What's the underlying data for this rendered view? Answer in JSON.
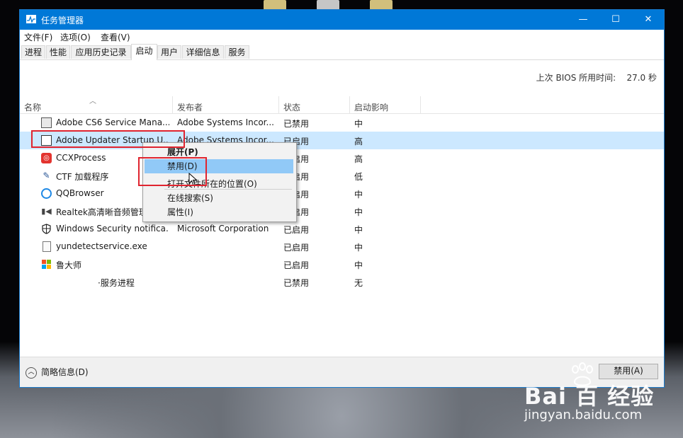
{
  "window": {
    "title": "任务管理器",
    "controls": {
      "minimize": "—",
      "maximize": "☐",
      "close": "✕"
    }
  },
  "menubar": [
    "文件(F)",
    "选项(O)",
    "查看(V)"
  ],
  "tabs": [
    {
      "label": "进程",
      "active": false
    },
    {
      "label": "性能",
      "active": false
    },
    {
      "label": "应用历史记录",
      "active": false
    },
    {
      "label": "启动",
      "active": true
    },
    {
      "label": "用户",
      "active": false
    },
    {
      "label": "详细信息",
      "active": false
    },
    {
      "label": "服务",
      "active": false
    }
  ],
  "bios": {
    "label": "上次 BIOS 所用时间:",
    "value": "27.0 秒"
  },
  "columns": {
    "name": "名称",
    "publisher": "发布者",
    "status": "状态",
    "impact": "启动影响"
  },
  "rows": [
    {
      "name": "Adobe CS6 Service Mana...",
      "publisher": "Adobe Systems Incor...",
      "status": "已禁用",
      "impact": "中",
      "icon": "adobe-cs6-icon",
      "selected": false
    },
    {
      "name": "Adobe Updater Startup U...",
      "publisher": "Adobe Systems Incor...",
      "status": "已启用",
      "impact": "高",
      "icon": "adobe-updater-icon",
      "selected": true
    },
    {
      "name": "CCXProcess",
      "publisher": "",
      "status": "已启用",
      "impact": "高",
      "icon": "ccx-process-icon",
      "selected": false
    },
    {
      "name": "CTF 加载程序",
      "publisher": "",
      "status": "已启用",
      "impact": "低",
      "icon": "ctf-loader-icon",
      "selected": false
    },
    {
      "name": "QQBrowser",
      "publisher": "",
      "status": "已启用",
      "impact": "中",
      "icon": "qqbrowser-icon",
      "selected": false
    },
    {
      "name": "Realtek高清晰音频管理",
      "publisher": "",
      "status": "已启用",
      "impact": "中",
      "icon": "realtek-audio-icon",
      "selected": false
    },
    {
      "name": "Windows Security notifica...",
      "publisher": "Microsoft Corporation",
      "status": "已启用",
      "impact": "中",
      "icon": "windows-security-icon",
      "selected": false
    },
    {
      "name": "yundetectservice.exe",
      "publisher": "",
      "status": "已启用",
      "impact": "中",
      "icon": "exe-file-icon",
      "selected": false
    },
    {
      "name": "鲁大师",
      "publisher": "",
      "status": "已启用",
      "impact": "中",
      "icon": "ludashi-icon",
      "selected": false
    },
    {
      "name": "·服务进程",
      "publisher": "",
      "status": "已禁用",
      "impact": "无",
      "icon": "",
      "selected": false
    }
  ],
  "context_menu": [
    {
      "label": "展开(P)",
      "bold": true,
      "highlighted": false
    },
    {
      "label": "禁用(D)",
      "bold": false,
      "highlighted": true
    },
    {
      "label": "打开文件所在的位置(O)",
      "bold": false,
      "highlighted": false
    },
    {
      "label": "在线搜索(S)",
      "bold": false,
      "highlighted": false
    },
    {
      "label": "属性(I)",
      "bold": false,
      "highlighted": false
    }
  ],
  "footer": {
    "less_details": "简略信息(D)",
    "disable_button": "禁用(A)"
  },
  "watermark": {
    "logo": "Bai 百 经验",
    "url": "jingyan.baidu.com"
  },
  "colors": {
    "titlebar": "#0078d7",
    "selection": "#cce8ff",
    "menu_highlight": "#91c9f7",
    "annotation": "#e0242f"
  }
}
